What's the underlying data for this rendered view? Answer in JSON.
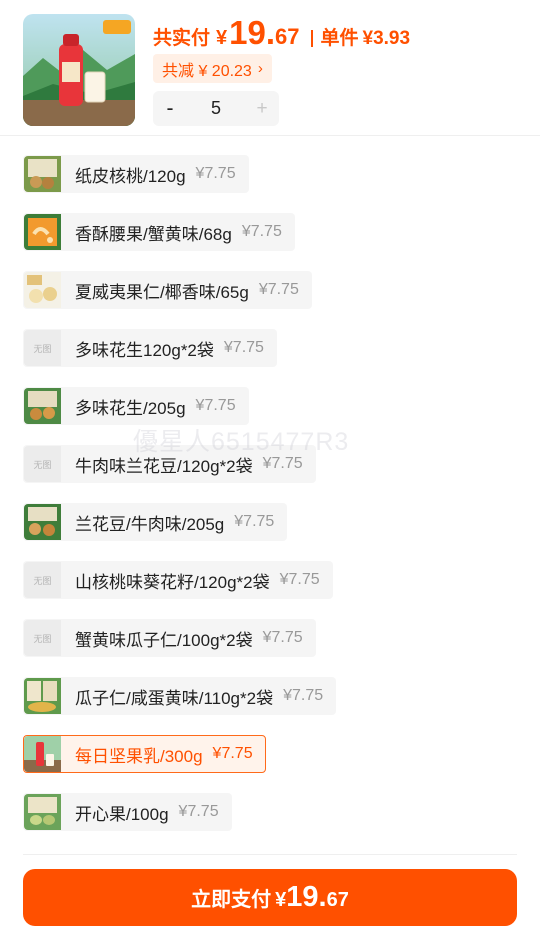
{
  "summary": {
    "total_label": "共实付",
    "currency": "¥",
    "total_int": "19.",
    "total_dec": "67",
    "unit_label": "单件",
    "unit_price": "¥3.93",
    "discount_label": "共减 ¥ 20.23",
    "discount_arrow": "›",
    "quantity": "5",
    "minus": "-",
    "plus": "+"
  },
  "options": [
    {
      "name": "纸皮核桃/120g",
      "price": "¥7.75",
      "has_image": true,
      "thumb": "walnut-icon"
    },
    {
      "name": "香酥腰果/蟹黄味/68g",
      "price": "¥7.75",
      "has_image": true,
      "thumb": "cashew-icon"
    },
    {
      "name": "夏威夷果仁/椰香味/65g",
      "price": "¥7.75",
      "has_image": true,
      "thumb": "macadamia-icon"
    },
    {
      "name": "多味花生120g*2袋",
      "price": "¥7.75",
      "has_image": false,
      "thumb_text": "无图"
    },
    {
      "name": "多味花生/205g",
      "price": "¥7.75",
      "has_image": true,
      "thumb": "peanut-icon"
    },
    {
      "name": "牛肉味兰花豆/120g*2袋",
      "price": "¥7.75",
      "has_image": false,
      "thumb_text": "无图"
    },
    {
      "name": "兰花豆/牛肉味/205g",
      "price": "¥7.75",
      "has_image": true,
      "thumb": "broad-bean-icon"
    },
    {
      "name": "山核桃味葵花籽/120g*2袋",
      "price": "¥7.75",
      "has_image": false,
      "thumb_text": "无图"
    },
    {
      "name": "蟹黄味瓜子仁/100g*2袋",
      "price": "¥7.75",
      "has_image": false,
      "thumb_text": "无图"
    },
    {
      "name": "瓜子仁/咸蛋黄味/110g*2袋",
      "price": "¥7.75",
      "has_image": true,
      "thumb": "seed-kernel-icon"
    },
    {
      "name": "每日坚果乳/300g",
      "price": "¥7.75",
      "has_image": true,
      "thumb": "nut-milk-icon",
      "selected": true
    },
    {
      "name": "开心果/100g",
      "price": "¥7.75",
      "has_image": true,
      "thumb": "pistachio-icon"
    }
  ],
  "watermark": "優星人6515477R3",
  "pay_button": {
    "label": "立即支付",
    "currency": "¥",
    "amount_int": "19.",
    "amount_dec": "67"
  },
  "colors": {
    "accent": "#ff5000",
    "selected_bg": "#fff3eb",
    "option_bg": "#f5f5f5"
  }
}
